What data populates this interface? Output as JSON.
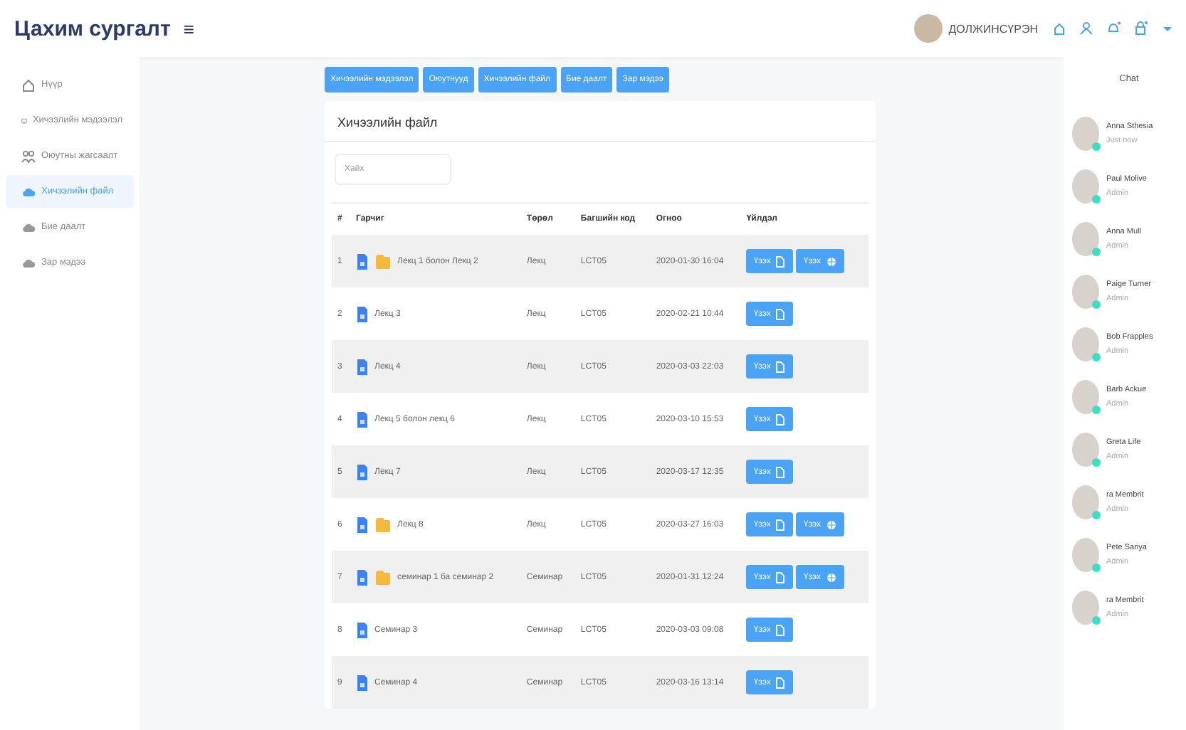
{
  "header": {
    "title": "Цахим сургалт",
    "menu_glyph": "≡",
    "user_name": "ДОЛЖИНСҮРЭН"
  },
  "sidebar": {
    "items": [
      {
        "kind": "home",
        "label": "Нүүр",
        "selected": false
      },
      {
        "kind": "board",
        "label": "Хичээлийн мэдээлэл",
        "selected": false
      },
      {
        "kind": "people",
        "label": "Оюутны жагсаалт",
        "selected": false
      },
      {
        "kind": "cloud",
        "label": "Хичээлийн файл",
        "selected": true
      },
      {
        "kind": "cloud",
        "label": "Бие даалт",
        "selected": false
      },
      {
        "kind": "cloud",
        "label": "Зар мэдээ",
        "selected": false
      }
    ]
  },
  "tabs": [
    {
      "label": "Хичээлийн мэдээлэл"
    },
    {
      "label": "Оюутнууд"
    },
    {
      "label": "Хичээлийн файл"
    },
    {
      "label": "Бие даалт"
    },
    {
      "label": "Зар мэдээ"
    }
  ],
  "card": {
    "title": "Хичээлийн файл",
    "search": {
      "placeholder": "Хайх"
    },
    "table": {
      "columns": [
        "#",
        "Гарчиг",
        "Төрөл",
        "Багшийн код",
        "Огноо",
        "Үйлдэл"
      ],
      "rows": [
        {
          "num": "1",
          "folder": true,
          "title": "Лекц 1 болон Лекц 2",
          "type": "Лекц",
          "code": "LCT05",
          "date": "2020-01-30 16:04",
          "actions": [
            {
              "kind": "file",
              "label": "Үзэх"
            },
            {
              "kind": "web",
              "label": "Үзэх"
            }
          ]
        },
        {
          "num": "2",
          "folder": false,
          "title": "Лекц 3",
          "type": "Лекц",
          "code": "LCT05",
          "date": "2020-02-21 10:44",
          "actions": [
            {
              "kind": "file",
              "label": "Үзэх"
            }
          ]
        },
        {
          "num": "3",
          "folder": false,
          "title": "Лекц 4",
          "type": "Лекц",
          "code": "LCT05",
          "date": "2020-03-03 22:03",
          "actions": [
            {
              "kind": "file",
              "label": "Үзэх"
            }
          ]
        },
        {
          "num": "4",
          "folder": false,
          "title": "Лекц 5 болон лекц 6",
          "type": "Лекц",
          "code": "LCT05",
          "date": "2020-03-10 15:53",
          "actions": [
            {
              "kind": "file",
              "label": "Үзэх"
            }
          ]
        },
        {
          "num": "5",
          "folder": false,
          "title": "Лекц 7",
          "type": "Лекц",
          "code": "LCT05",
          "date": "2020-03-17 12:35",
          "actions": [
            {
              "kind": "file",
              "label": "Үзэх"
            }
          ]
        },
        {
          "num": "6",
          "folder": true,
          "title": "Лекц 8",
          "type": "Лекц",
          "code": "LCT05",
          "date": "2020-03-27 16:03",
          "actions": [
            {
              "kind": "file",
              "label": "Үзэх"
            },
            {
              "kind": "web",
              "label": "Үзэх"
            }
          ]
        },
        {
          "num": "7",
          "folder": true,
          "title": "семинар 1 ба семинар 2",
          "type": "Семинар",
          "code": "LCT05",
          "date": "2020-01-31 12:24",
          "actions": [
            {
              "kind": "file",
              "label": "Үзэх"
            },
            {
              "kind": "web",
              "label": "Үзэх"
            }
          ]
        },
        {
          "num": "8",
          "folder": false,
          "title": "Семинар 3",
          "type": "Семинар",
          "code": "LCT05",
          "date": "2020-03-03 09:08",
          "actions": [
            {
              "kind": "file",
              "label": "Үзэх"
            }
          ]
        },
        {
          "num": "9",
          "folder": false,
          "title": "Семинар 4",
          "type": "Семинар",
          "code": "LCT05",
          "date": "2020-03-16 13:14",
          "actions": [
            {
              "kind": "file",
              "label": "Үзэх"
            }
          ]
        }
      ]
    }
  },
  "chat": {
    "title": "Chat",
    "contacts": [
      {
        "name": "Anna Sthesia",
        "status": "Just now",
        "online": true
      },
      {
        "name": "Paul Molive",
        "status": "Admin",
        "online": true
      },
      {
        "name": "Anna Mull",
        "status": "Admin",
        "online": true
      },
      {
        "name": "Paige Turner",
        "status": "Admin",
        "online": true
      },
      {
        "name": "Bob Frapples",
        "status": "Admin",
        "online": true
      },
      {
        "name": "Barb Ackue",
        "status": "Admin",
        "online": true
      },
      {
        "name": "Greta Life",
        "status": "Admin",
        "online": true
      },
      {
        "name": "ra Membrit",
        "status": "Admin",
        "online": true
      },
      {
        "name": "Pete Sariya",
        "status": "Admin",
        "online": true
      },
      {
        "name": "ra Membrit",
        "status": "Admin",
        "online": true
      }
    ]
  }
}
